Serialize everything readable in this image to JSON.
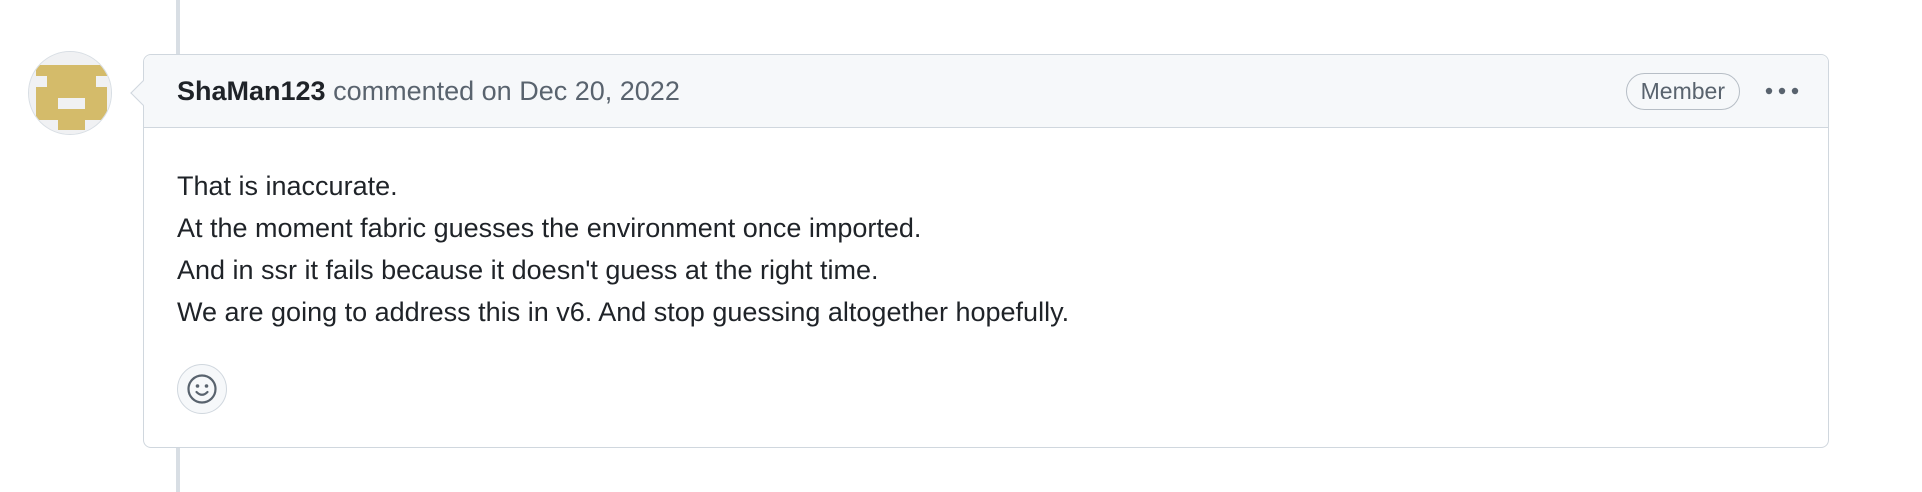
{
  "comment": {
    "author": "ShaMan123",
    "action": "commented on",
    "date": "Dec 20, 2022",
    "role_badge": "Member",
    "more_icon": "kebab-horizontal-icon",
    "reaction_icon": "smiley-icon",
    "avatar_color": "#d4bb6a",
    "body_lines": [
      "That is inaccurate.",
      "At the moment fabric guesses the environment once imported.",
      "And in ssr it fails because it doesn't guess at the right time.",
      "We are going to address this in v6. And stop guessing altogether hopefully."
    ]
  }
}
